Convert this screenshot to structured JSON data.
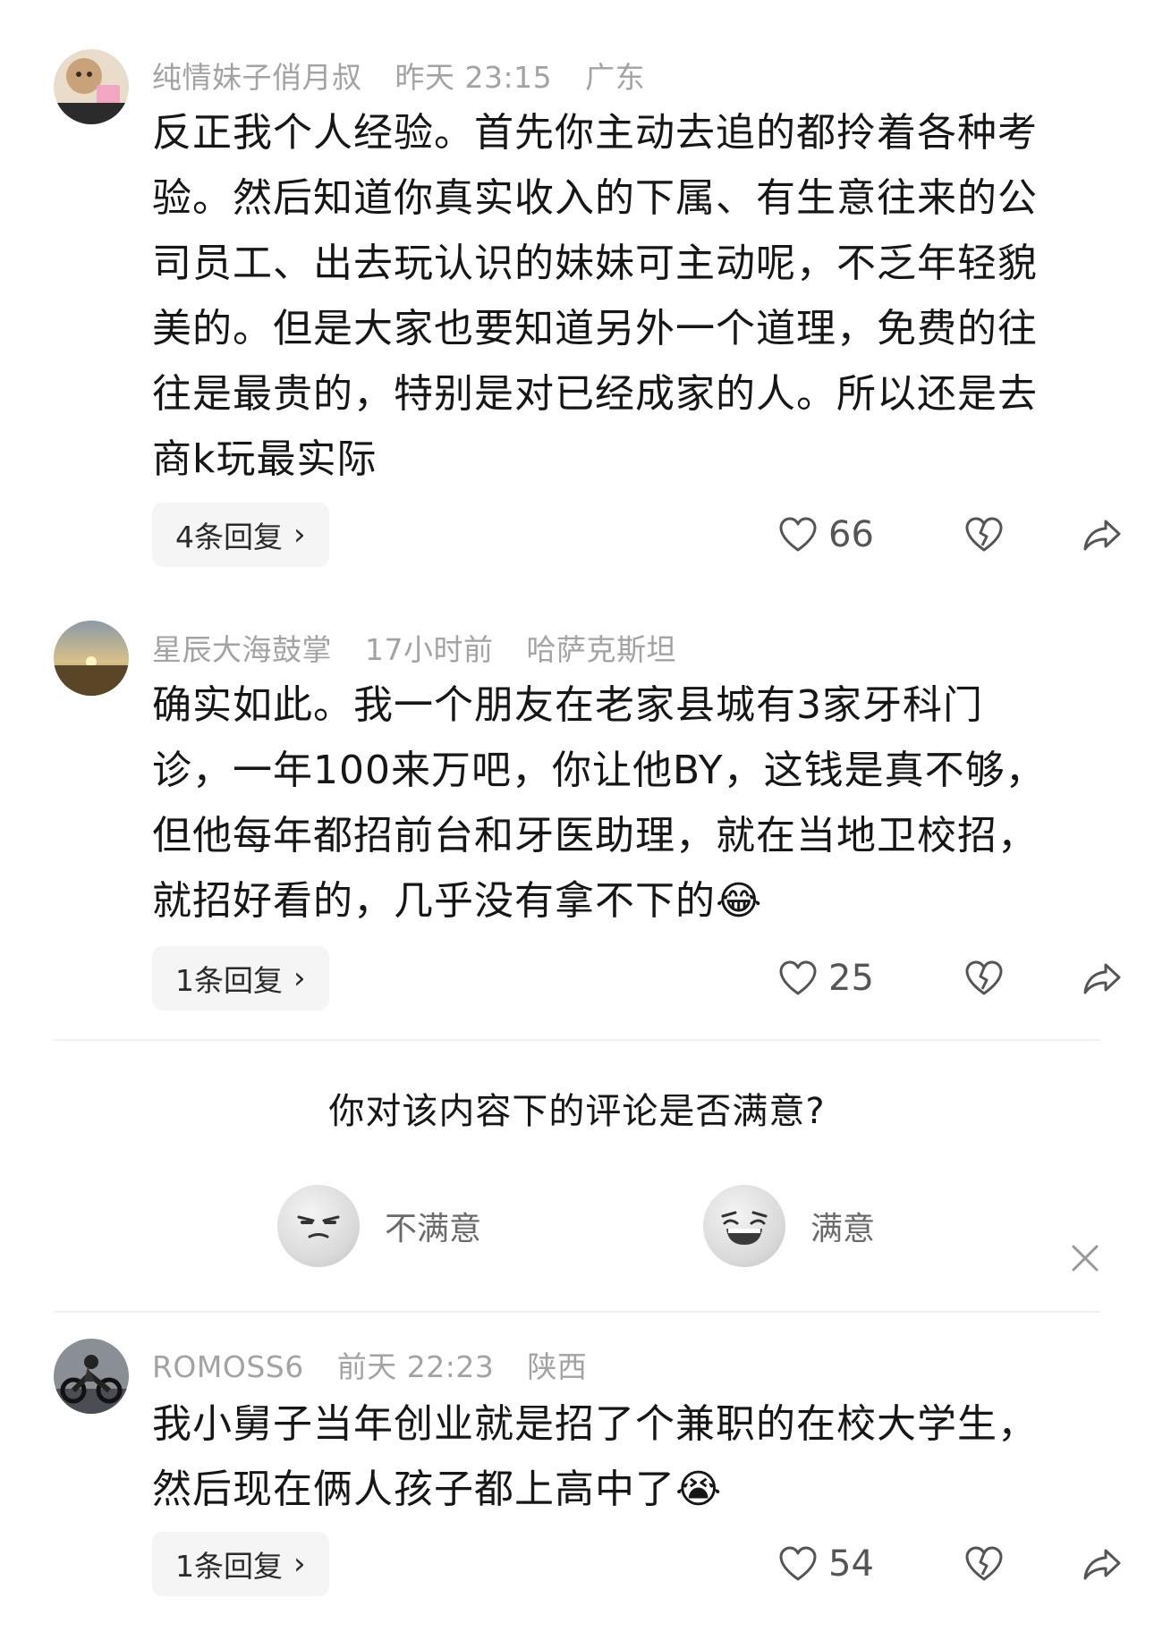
{
  "comments": [
    {
      "username": "纯情妹子俏月叔",
      "time": "昨天 23:15",
      "location": "广东",
      "lines": [
        "反正我个人经验。首先你主动去追的都拎着各种考",
        "验。然后知道你真实收入的下属、有生意往来的公",
        "司员工、出去玩认识的妹妹可主动呢，不乏年轻貌",
        "美的。但是大家也要知道另外一个道理，免费的往",
        "往是最贵的，特别是对已经成家的人。所以还是去",
        "商k玩最实际"
      ],
      "replies": "4条回复",
      "likes": "66",
      "avatar": "doll-avatar"
    },
    {
      "username": "星辰大海鼓掌",
      "time": "17小时前",
      "location": "哈萨克斯坦",
      "lines": [
        "确实如此。我一个朋友在老家县城有3家牙科门",
        "诊，一年100来万吧，你让他BY，这钱是真不够，",
        "但他每年都招前台和牙医助理，就在当地卫校招，",
        "就招好看的，几乎没有拿不下的😂"
      ],
      "replies": "1条回复",
      "likes": "25",
      "avatar": "sunset-avatar"
    },
    {
      "username": "ROMOSS6",
      "time": "前天 22:23",
      "location": "陕西",
      "lines": [
        "我小舅子当年创业就是招了个兼职的在校大学生，",
        "然后现在俩人孩子都上高中了😭"
      ],
      "replies": "1条回复",
      "likes": "54",
      "avatar": "motorcycle-avatar"
    }
  ],
  "survey": {
    "title": "你对该内容下的评论是否满意?",
    "unsatisfied": "不满意",
    "satisfied": "满意"
  }
}
